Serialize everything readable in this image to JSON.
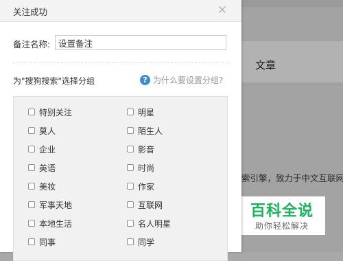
{
  "background": {
    "article_tab": "文章",
    "snippet": "索引擎，致力于中文互联网信"
  },
  "watermark": {
    "title": "百科全说",
    "subtitle": "助你轻松解决"
  },
  "dialog": {
    "title": "关注成功",
    "close_icon": "close-icon",
    "remark": {
      "label": "备注名称:",
      "value": "设置备注"
    },
    "group_label": "为\"搜狗搜索\"选择分组",
    "help": {
      "icon": "question-icon",
      "text": "为什么要设置分组?"
    },
    "groups": [
      [
        "特别关注",
        "明星"
      ],
      [
        "莫人",
        "陌生人"
      ],
      [
        "企业",
        "影音"
      ],
      [
        "英语",
        "时尚"
      ],
      [
        "美妆",
        "作家"
      ],
      [
        "军事天地",
        "互联网"
      ],
      [
        "本地生活",
        "名人明星"
      ],
      [
        "同事",
        "同学"
      ]
    ]
  },
  "colors": {
    "accent": "#3c8dd1",
    "watermark_green": "#1bb35a"
  }
}
